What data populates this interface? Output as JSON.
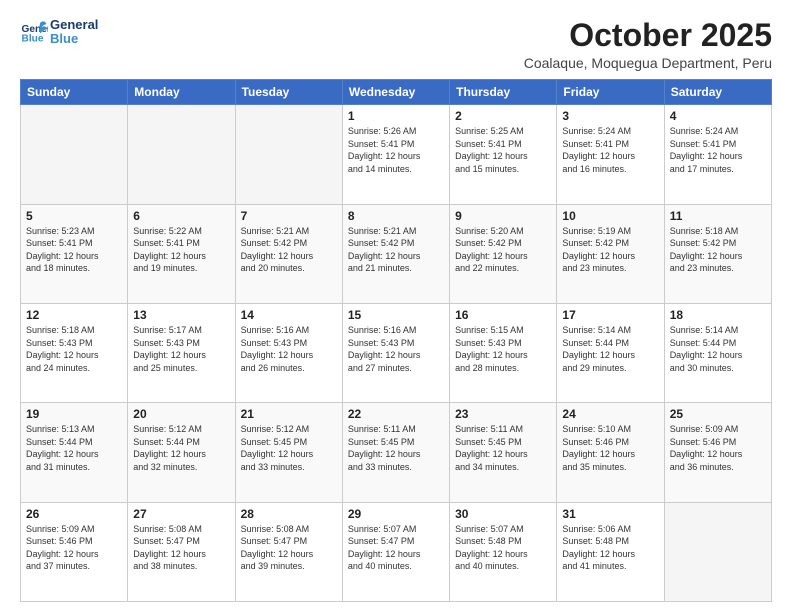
{
  "logo": {
    "line1": "General",
    "line2": "Blue"
  },
  "title": "October 2025",
  "subtitle": "Coalaque, Moquegua Department, Peru",
  "days_of_week": [
    "Sunday",
    "Monday",
    "Tuesday",
    "Wednesday",
    "Thursday",
    "Friday",
    "Saturday"
  ],
  "weeks": [
    [
      {
        "day": "",
        "info": ""
      },
      {
        "day": "",
        "info": ""
      },
      {
        "day": "",
        "info": ""
      },
      {
        "day": "1",
        "info": "Sunrise: 5:26 AM\nSunset: 5:41 PM\nDaylight: 12 hours\nand 14 minutes."
      },
      {
        "day": "2",
        "info": "Sunrise: 5:25 AM\nSunset: 5:41 PM\nDaylight: 12 hours\nand 15 minutes."
      },
      {
        "day": "3",
        "info": "Sunrise: 5:24 AM\nSunset: 5:41 PM\nDaylight: 12 hours\nand 16 minutes."
      },
      {
        "day": "4",
        "info": "Sunrise: 5:24 AM\nSunset: 5:41 PM\nDaylight: 12 hours\nand 17 minutes."
      }
    ],
    [
      {
        "day": "5",
        "info": "Sunrise: 5:23 AM\nSunset: 5:41 PM\nDaylight: 12 hours\nand 18 minutes."
      },
      {
        "day": "6",
        "info": "Sunrise: 5:22 AM\nSunset: 5:41 PM\nDaylight: 12 hours\nand 19 minutes."
      },
      {
        "day": "7",
        "info": "Sunrise: 5:21 AM\nSunset: 5:42 PM\nDaylight: 12 hours\nand 20 minutes."
      },
      {
        "day": "8",
        "info": "Sunrise: 5:21 AM\nSunset: 5:42 PM\nDaylight: 12 hours\nand 21 minutes."
      },
      {
        "day": "9",
        "info": "Sunrise: 5:20 AM\nSunset: 5:42 PM\nDaylight: 12 hours\nand 22 minutes."
      },
      {
        "day": "10",
        "info": "Sunrise: 5:19 AM\nSunset: 5:42 PM\nDaylight: 12 hours\nand 23 minutes."
      },
      {
        "day": "11",
        "info": "Sunrise: 5:18 AM\nSunset: 5:42 PM\nDaylight: 12 hours\nand 23 minutes."
      }
    ],
    [
      {
        "day": "12",
        "info": "Sunrise: 5:18 AM\nSunset: 5:43 PM\nDaylight: 12 hours\nand 24 minutes."
      },
      {
        "day": "13",
        "info": "Sunrise: 5:17 AM\nSunset: 5:43 PM\nDaylight: 12 hours\nand 25 minutes."
      },
      {
        "day": "14",
        "info": "Sunrise: 5:16 AM\nSunset: 5:43 PM\nDaylight: 12 hours\nand 26 minutes."
      },
      {
        "day": "15",
        "info": "Sunrise: 5:16 AM\nSunset: 5:43 PM\nDaylight: 12 hours\nand 27 minutes."
      },
      {
        "day": "16",
        "info": "Sunrise: 5:15 AM\nSunset: 5:43 PM\nDaylight: 12 hours\nand 28 minutes."
      },
      {
        "day": "17",
        "info": "Sunrise: 5:14 AM\nSunset: 5:44 PM\nDaylight: 12 hours\nand 29 minutes."
      },
      {
        "day": "18",
        "info": "Sunrise: 5:14 AM\nSunset: 5:44 PM\nDaylight: 12 hours\nand 30 minutes."
      }
    ],
    [
      {
        "day": "19",
        "info": "Sunrise: 5:13 AM\nSunset: 5:44 PM\nDaylight: 12 hours\nand 31 minutes."
      },
      {
        "day": "20",
        "info": "Sunrise: 5:12 AM\nSunset: 5:44 PM\nDaylight: 12 hours\nand 32 minutes."
      },
      {
        "day": "21",
        "info": "Sunrise: 5:12 AM\nSunset: 5:45 PM\nDaylight: 12 hours\nand 33 minutes."
      },
      {
        "day": "22",
        "info": "Sunrise: 5:11 AM\nSunset: 5:45 PM\nDaylight: 12 hours\nand 33 minutes."
      },
      {
        "day": "23",
        "info": "Sunrise: 5:11 AM\nSunset: 5:45 PM\nDaylight: 12 hours\nand 34 minutes."
      },
      {
        "day": "24",
        "info": "Sunrise: 5:10 AM\nSunset: 5:46 PM\nDaylight: 12 hours\nand 35 minutes."
      },
      {
        "day": "25",
        "info": "Sunrise: 5:09 AM\nSunset: 5:46 PM\nDaylight: 12 hours\nand 36 minutes."
      }
    ],
    [
      {
        "day": "26",
        "info": "Sunrise: 5:09 AM\nSunset: 5:46 PM\nDaylight: 12 hours\nand 37 minutes."
      },
      {
        "day": "27",
        "info": "Sunrise: 5:08 AM\nSunset: 5:47 PM\nDaylight: 12 hours\nand 38 minutes."
      },
      {
        "day": "28",
        "info": "Sunrise: 5:08 AM\nSunset: 5:47 PM\nDaylight: 12 hours\nand 39 minutes."
      },
      {
        "day": "29",
        "info": "Sunrise: 5:07 AM\nSunset: 5:47 PM\nDaylight: 12 hours\nand 40 minutes."
      },
      {
        "day": "30",
        "info": "Sunrise: 5:07 AM\nSunset: 5:48 PM\nDaylight: 12 hours\nand 40 minutes."
      },
      {
        "day": "31",
        "info": "Sunrise: 5:06 AM\nSunset: 5:48 PM\nDaylight: 12 hours\nand 41 minutes."
      },
      {
        "day": "",
        "info": ""
      }
    ]
  ]
}
